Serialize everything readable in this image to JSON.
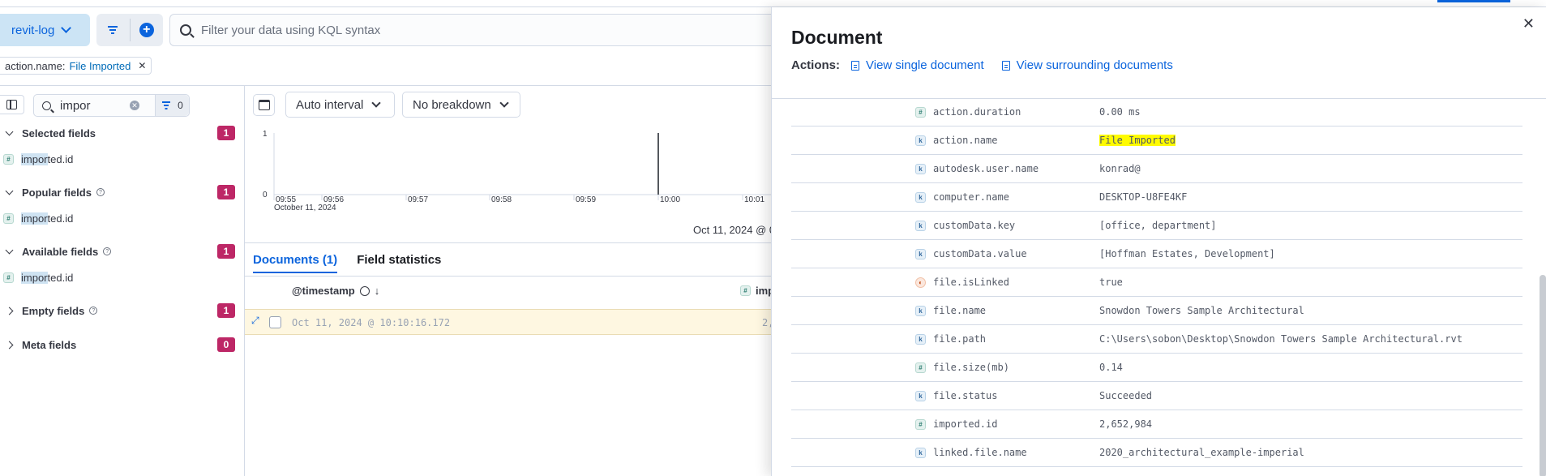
{
  "header": {
    "data_view": "revit-log",
    "query_placeholder": "Filter your data using KQL syntax",
    "filter_pill": {
      "field": "action.name:",
      "value": "File Imported"
    }
  },
  "sidebar": {
    "search_value": "impor",
    "filter_count": "0",
    "sections": [
      {
        "title": "Selected fields",
        "count": "1",
        "field": {
          "type": "#",
          "match": "impor",
          "rest": "ted.id"
        }
      },
      {
        "title": "Popular fields",
        "count": "1",
        "field": {
          "type": "#",
          "match": "impor",
          "rest": "ted.id"
        }
      },
      {
        "title": "Available fields",
        "count": "1",
        "field": {
          "type": "#",
          "match": "impor",
          "rest": "ted.id"
        }
      },
      {
        "title": "Empty fields",
        "count": "1"
      },
      {
        "title": "Meta fields",
        "count": "0"
      }
    ]
  },
  "chart": {
    "interval": "Auto interval",
    "breakdown": "No breakdown",
    "y_ticks": [
      "1",
      "0"
    ],
    "x_ticks": [
      "09:55",
      "09:56",
      "09:57",
      "09:58",
      "09:59",
      "10:00",
      "10:01"
    ],
    "x_sub": "October 11, 2024",
    "time_range": "Oct 11, 2024 @ 0"
  },
  "documents": {
    "tab_documents": "Documents (1)",
    "tab_stats": "Field statistics",
    "col_timestamp": "@timestamp",
    "col_imported": "imp",
    "row_timestamp": "Oct 11, 2024 @ 10:10:16.172",
    "row_imported": "2,"
  },
  "flyout": {
    "title": "Document",
    "actions_label": "Actions:",
    "view_single": "View single document",
    "view_surrounding": "View surrounding documents",
    "fields": [
      {
        "type": "#",
        "name": "action.duration",
        "value": "0.00 ms"
      },
      {
        "type": "k",
        "name": "action.name",
        "value": "File Imported",
        "highlight": true
      },
      {
        "type": "k",
        "name": "autodesk.user.name",
        "value": "konrad@"
      },
      {
        "type": "k",
        "name": "computer.name",
        "value": "DESKTOP-U8FE4KF"
      },
      {
        "type": "k",
        "name": "customData.key",
        "value": "[office, department]"
      },
      {
        "type": "k",
        "name": "customData.value",
        "value": "[Hoffman Estates, Development]"
      },
      {
        "type": "b",
        "name": "file.isLinked",
        "value": "true"
      },
      {
        "type": "k",
        "name": "file.name",
        "value": "Snowdon Towers Sample Architectural"
      },
      {
        "type": "k",
        "name": "file.path",
        "value": "C:\\Users\\sobon\\Desktop\\Snowdon Towers Sample Architectural.rvt"
      },
      {
        "type": "#",
        "name": "file.size(mb)",
        "value": "0.14"
      },
      {
        "type": "k",
        "name": "file.status",
        "value": "Succeeded"
      },
      {
        "type": "#",
        "name": "imported.id",
        "value": "2,652,984"
      },
      {
        "type": "k",
        "name": "linked.file.name",
        "value": "2020_architectural_example-imperial"
      }
    ]
  }
}
